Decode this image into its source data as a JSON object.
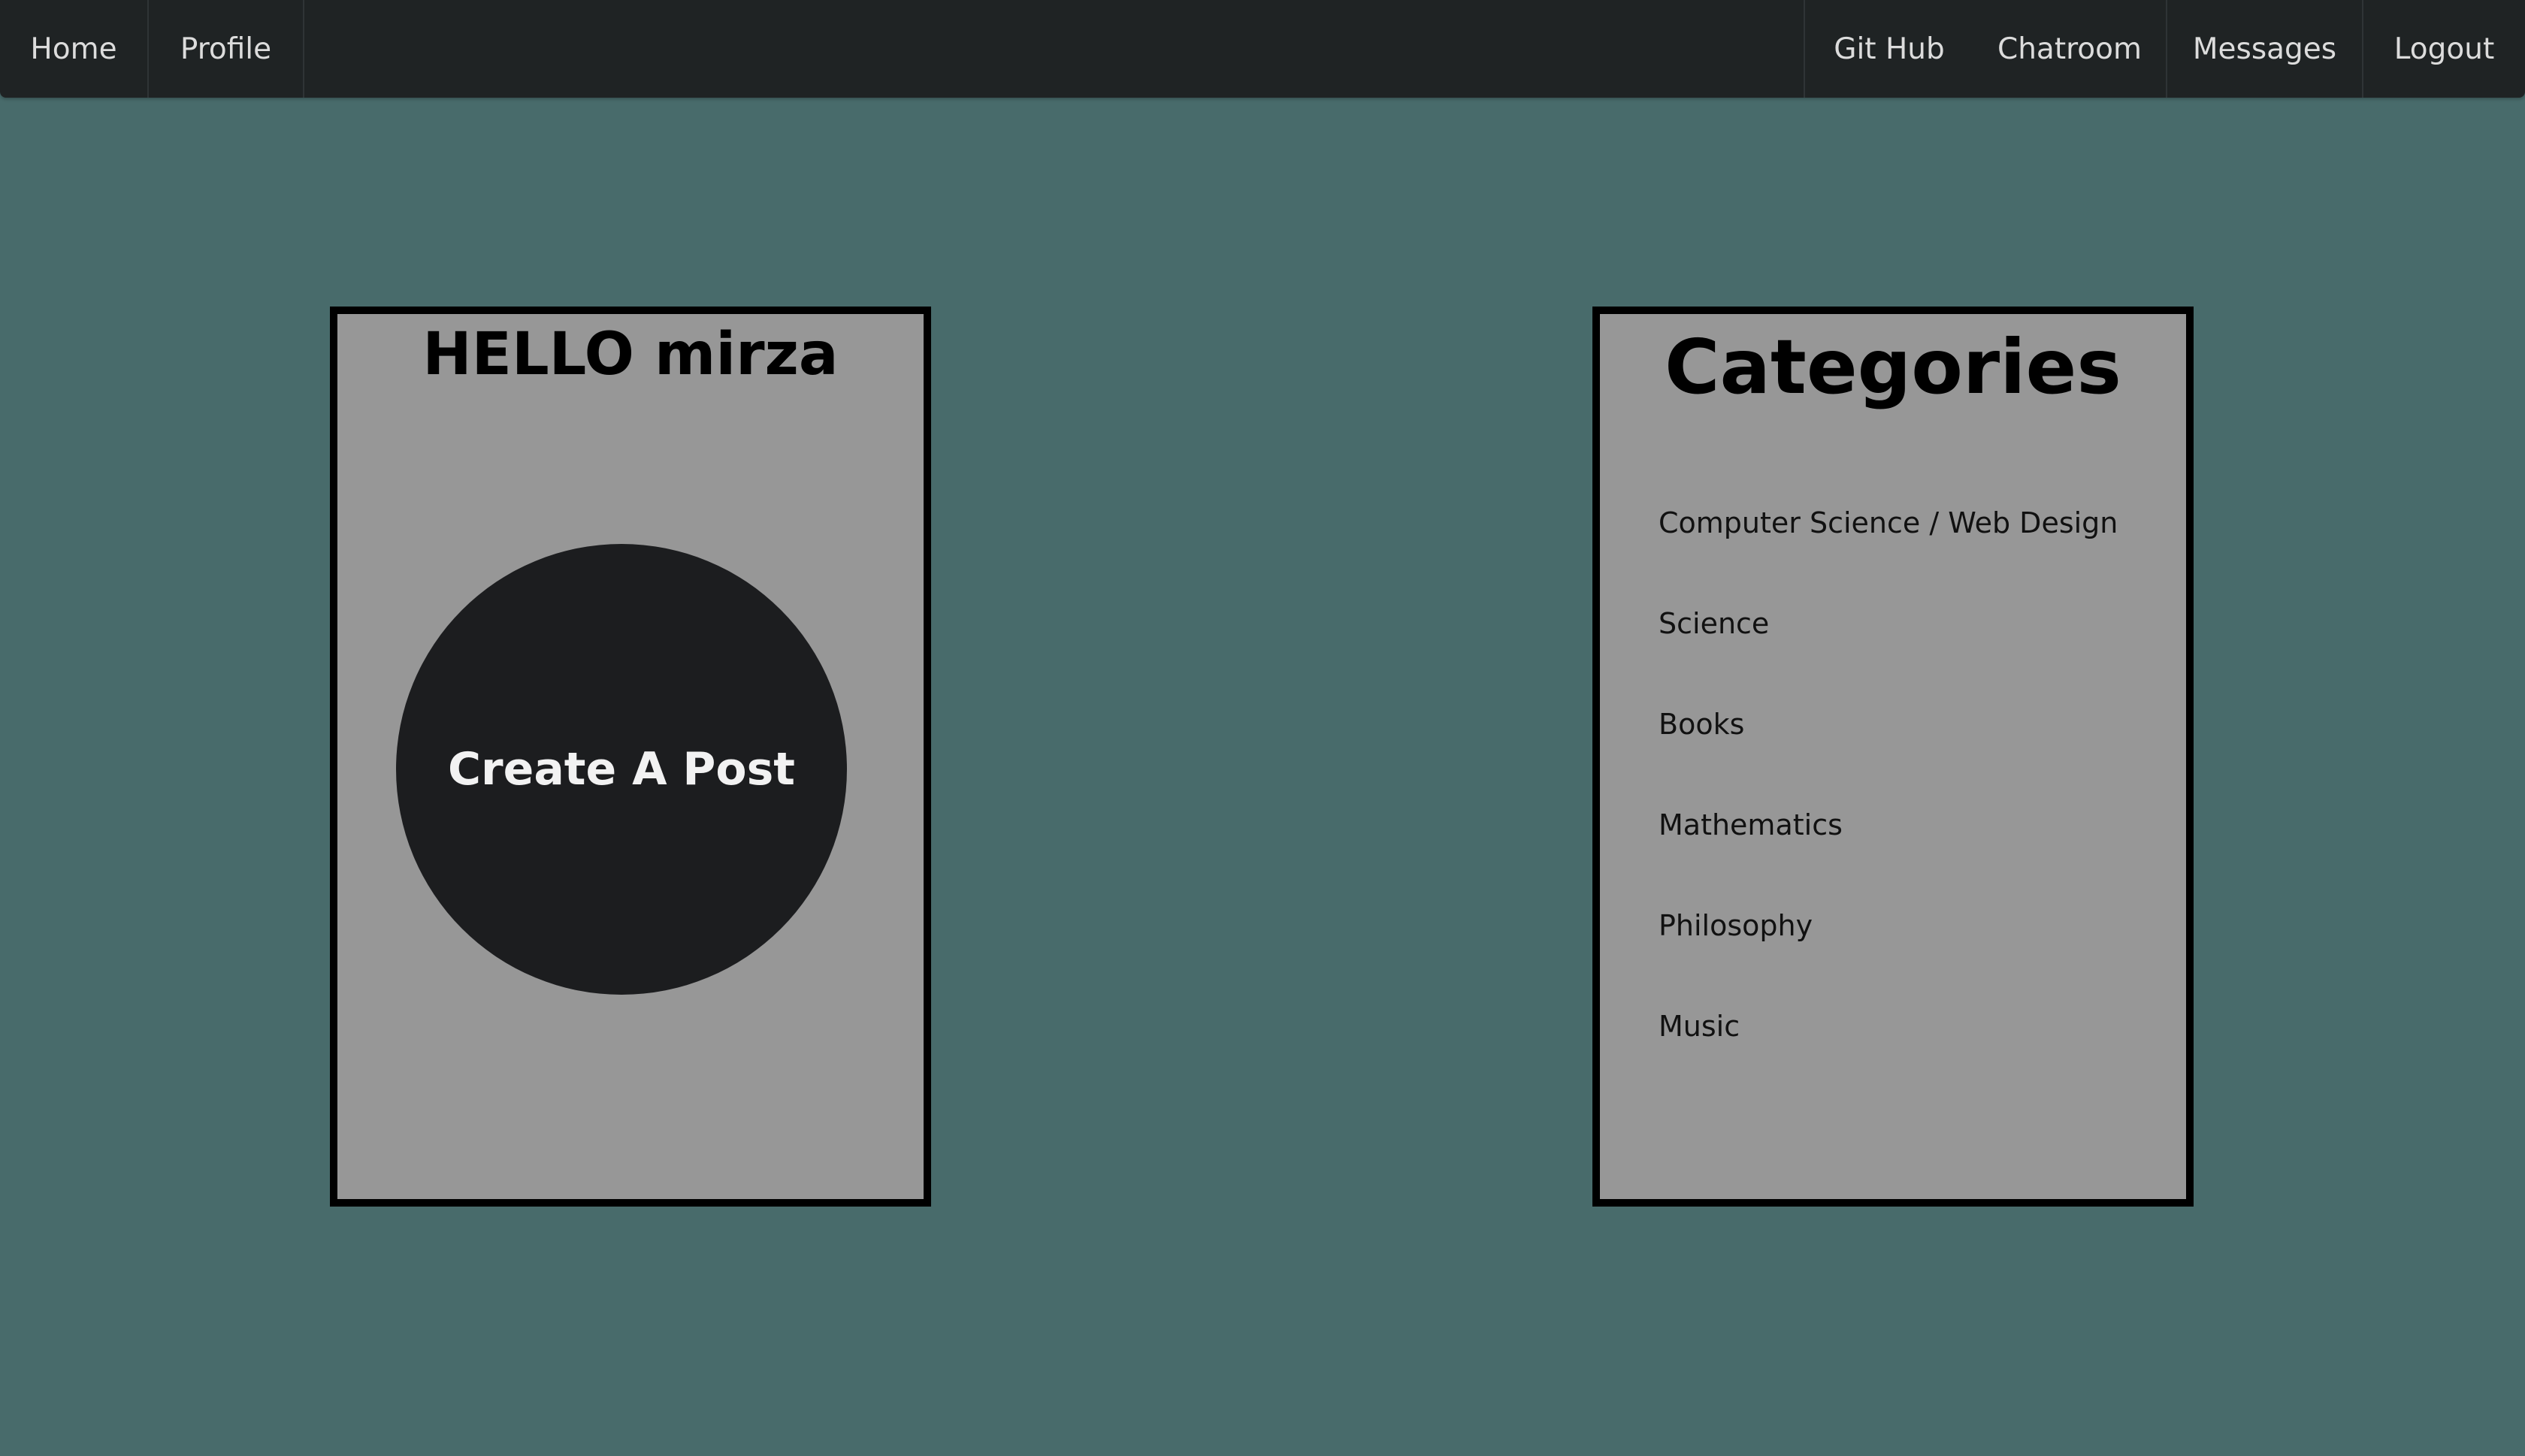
{
  "nav": {
    "left": [
      {
        "label": "Home"
      },
      {
        "label": "Profile"
      }
    ],
    "right": [
      {
        "label": "Git Hub"
      },
      {
        "label": "Chatroom"
      },
      {
        "label": "Messages"
      },
      {
        "label": "Logout"
      }
    ]
  },
  "greeting_card": {
    "title": "HELLO mirza",
    "button_label": "Create A Post"
  },
  "categories_card": {
    "title": "Categories",
    "items": [
      {
        "label": "Computer Science / Web Design"
      },
      {
        "label": "Science"
      },
      {
        "label": "Books"
      },
      {
        "label": "Mathematics"
      },
      {
        "label": "Philosophy"
      },
      {
        "label": "Music"
      }
    ]
  },
  "colors": {
    "background": "#486b6b",
    "navbar": "#1f2324",
    "card": "#979797",
    "card_border": "#000000",
    "button": "#1c1d1f"
  }
}
